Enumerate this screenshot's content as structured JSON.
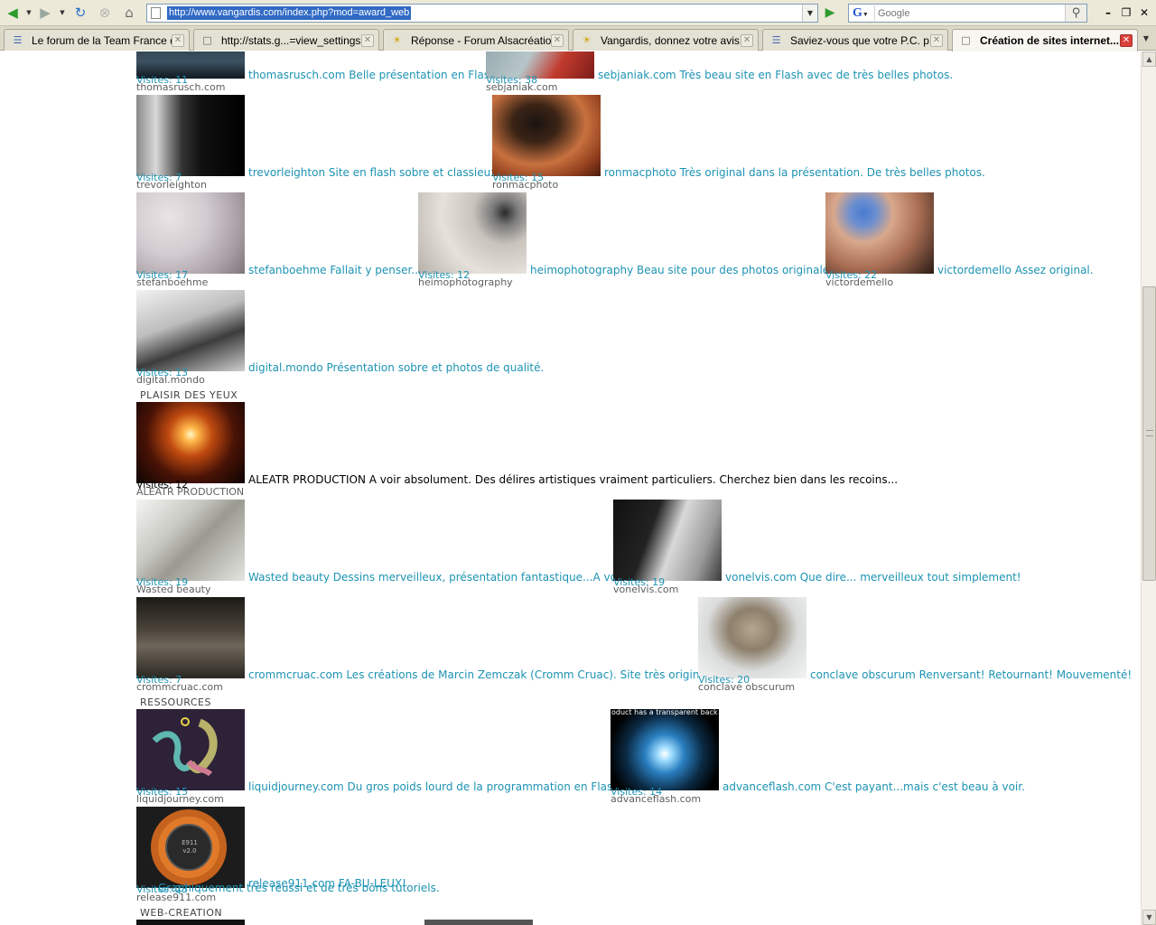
{
  "browser": {
    "url": "http://www.vangardis.com/index.php?mod=award_web",
    "search_engine": "G",
    "search_placeholder": "Google",
    "tabs": [
      {
        "label": "Le forum de la Team France d...",
        "icon": "forum-icon"
      },
      {
        "label": "http://stats.g...=view_settings",
        "icon": "page-icon"
      },
      {
        "label": "Réponse - Forum Alsacréatio...",
        "icon": "sun-icon"
      },
      {
        "label": "Vangardis, donnez votre avis...",
        "icon": "sun-icon"
      },
      {
        "label": "Saviez-vous que votre P.C. p...",
        "icon": "forum-icon"
      },
      {
        "label": "Création de sites internet...",
        "icon": "page-icon"
      }
    ]
  },
  "sections": {
    "plaisir": "PLAISIR DES YEUX",
    "ressources": "RESSOURCES",
    "webcreation": "WEB-CREATION"
  },
  "entries": [
    {
      "visits": "Visites: 11",
      "name": "thomasrusch.com",
      "desc": "thomasrusch.com Belle présentation en Flash"
    },
    {
      "visits": "Visites: 38",
      "name": "sebjaniak.com",
      "desc": "sebjaniak.com Très beau site en Flash avec de très belles photos."
    },
    {
      "visits": "Visites: 7",
      "name": "trevorleighton",
      "desc": "trevorleighton Site en flash sobre et classieux."
    },
    {
      "visits": "Visites: 15",
      "name": "ronmacphoto",
      "desc": "ronmacphoto Très original dans la présentation. De très belles photos."
    },
    {
      "visits": "Visites: 17",
      "name": "stefanboehme",
      "desc": "stefanboehme Fallait y penser..."
    },
    {
      "visits": "Visites: 12",
      "name": "heimophotography",
      "desc": "heimophotography Beau site pour des photos originales."
    },
    {
      "visits": "Visites: 22",
      "name": "victordemello",
      "desc": "victordemello Assez original."
    },
    {
      "visits": "Visites: 13",
      "name": "digital.mondo",
      "desc": "digital.mondo Présentation sobre et photos de qualité."
    },
    {
      "visits": "Visites: 12",
      "name": "ALEATR PRODUCTION",
      "desc": "ALEATR PRODUCTION A voir absolument. Des délires artistiques vraiment particuliers. Cherchez bien dans les recoins..."
    },
    {
      "visits": "Visites: 19",
      "name": "Wasted beauty",
      "desc": "Wasted beauty Dessins merveilleux, présentation fantastique...A voir."
    },
    {
      "visits": "Visites: 19",
      "name": "vonelvis.com",
      "desc": "vonelvis.com Que dire... merveilleux tout simplement!"
    },
    {
      "visits": "Visites: 7",
      "name": "crommcruac.com",
      "desc": "crommcruac.com Les créations de Marcin Zemczak (Cromm Cruac). Site très original."
    },
    {
      "visits": "Visites: 20",
      "name": "conclave obscurum",
      "desc": "conclave obscurum Renversant! Retournant! Mouvementé!"
    },
    {
      "visits": "Visites: 15",
      "name": "liquidjourney.com",
      "desc": "liquidjourney.com Du gros poids lourd de la programmation en Flash."
    },
    {
      "visits": "Visites: 14",
      "name": "advanceflash.com",
      "desc": "advanceflash.com C'est payant...mais c'est beau à voir."
    },
    {
      "visits": "Visites: 23",
      "name": "release911.com",
      "desc": "release911.com FA-BU-LEUX!",
      "desc2": "Graphiquement très réussi et de très bons tutoriels."
    }
  ],
  "thumb_texts": {
    "advanceflash": "oduct has a transparent back",
    "release911": "E911 v2.0"
  }
}
